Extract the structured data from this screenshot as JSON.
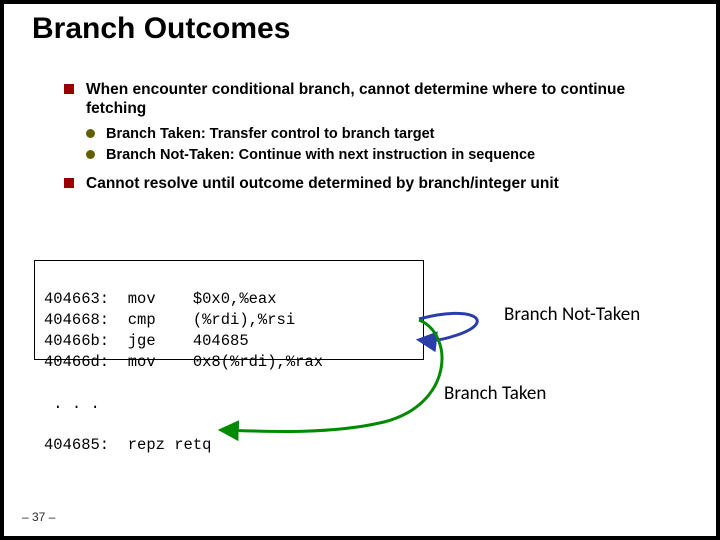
{
  "title": "Branch Outcomes",
  "bullets": {
    "b1a": "When encounter conditional branch, cannot determine where to continue fetching",
    "b2a": "Branch Taken: Transfer control to branch target",
    "b2b": "Branch Not-Taken: Continue with next instruction in sequence",
    "b1b": "Cannot resolve until outcome determined by branch/integer unit"
  },
  "code": {
    "l1": "404663:  mov    $0x0,%eax",
    "l2": "404668:  cmp    (%rdi),%rsi",
    "l3": "40466b:  jge    404685",
    "l4": "40466d:  mov    0x8(%rdi),%rax",
    "ellipsis": " . . .",
    "l5": "404685:  repz retq"
  },
  "labels": {
    "not_taken": "Branch Not-Taken",
    "taken": "Branch Taken"
  },
  "pagenum": "– 37 –"
}
